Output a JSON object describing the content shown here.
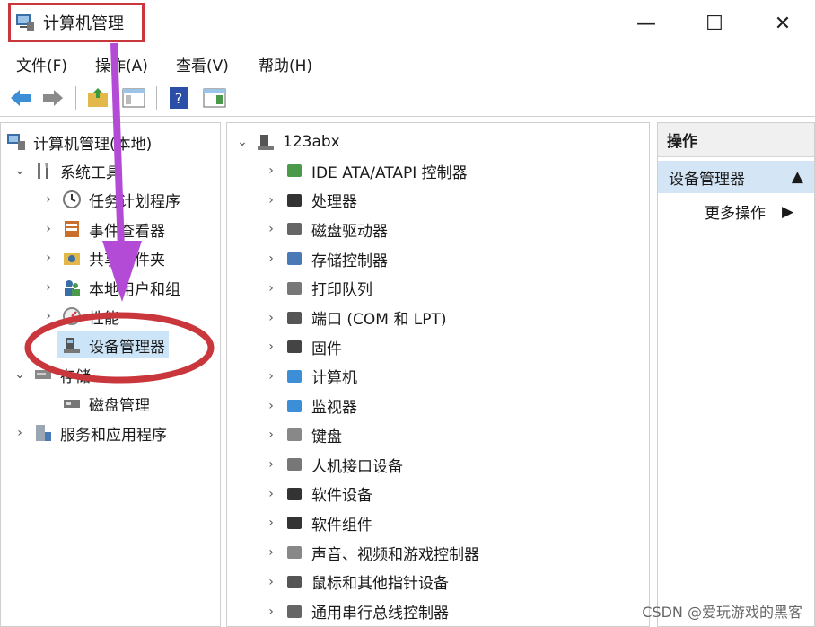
{
  "window": {
    "title": "计算机管理",
    "minimize": "—",
    "maximize": "☐",
    "close": "✕"
  },
  "menu": [
    "文件(F)",
    "操作(A)",
    "查看(V)",
    "帮助(H)"
  ],
  "toolbar": {
    "icons": [
      "back-arrow-icon",
      "forward-arrow-icon",
      "folder-up-icon",
      "show-hide-tree-icon",
      "help-icon",
      "action-pane-icon"
    ]
  },
  "tree": {
    "root": "计算机管理(本地)",
    "system_tools": "系统工具",
    "items": [
      "任务计划程序",
      "事件查看器",
      "共享文件夹",
      "本地用户和组",
      "性能",
      "设备管理器"
    ],
    "storage": "存储",
    "storage_items": [
      "磁盘管理"
    ],
    "services": "服务和应用程序"
  },
  "devices": {
    "host": "123abx",
    "list": [
      "IDE ATA/ATAPI 控制器",
      "处理器",
      "磁盘驱动器",
      "存储控制器",
      "打印队列",
      "端口 (COM 和 LPT)",
      "固件",
      "计算机",
      "监视器",
      "键盘",
      "人机接口设备",
      "软件设备",
      "软件组件",
      "声音、视频和游戏控制器",
      "鼠标和其他指针设备",
      "通用串行总线控制器"
    ]
  },
  "actions": {
    "header": "操作",
    "section": "设备管理器",
    "more": "更多操作"
  },
  "watermark": "CSDN @爱玩游戏的黑客",
  "colors": {
    "highlight": "#c9373d",
    "arrow": "#b44bd6",
    "selection": "#cce4f7"
  }
}
